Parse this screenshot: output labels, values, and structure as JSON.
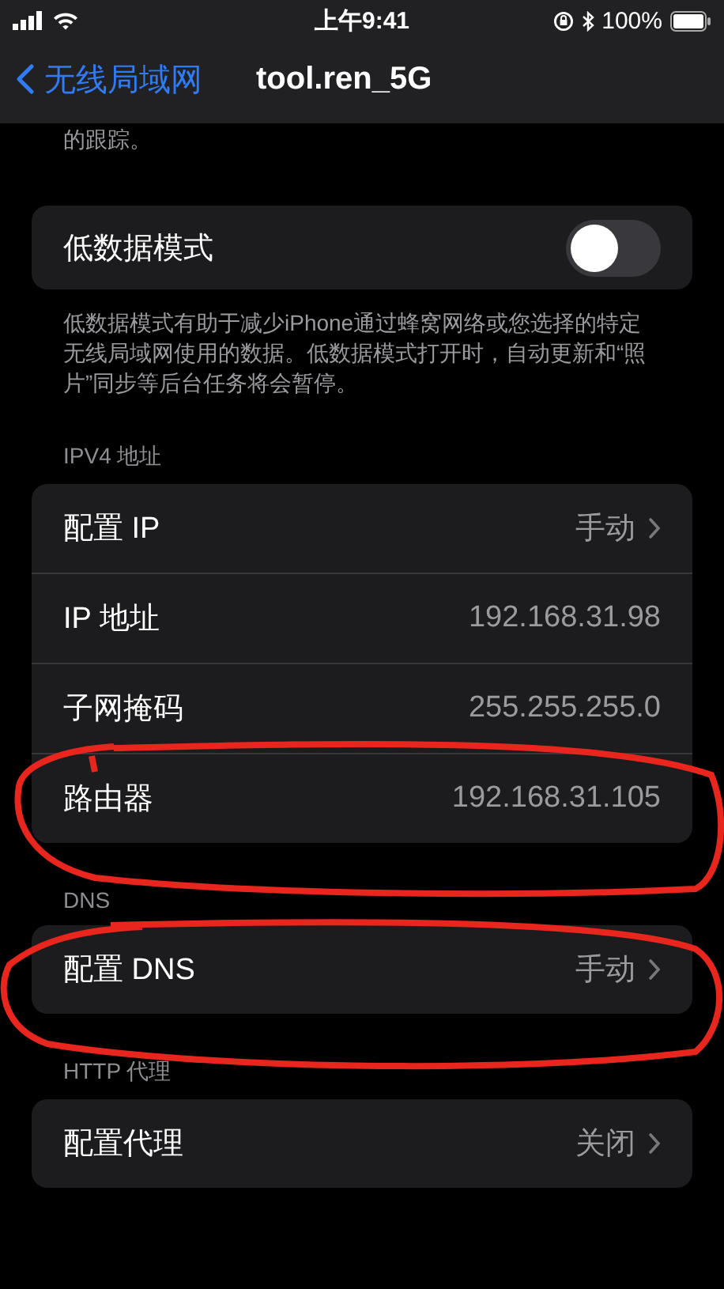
{
  "status_bar": {
    "time": "上午9:41",
    "battery": "100%"
  },
  "nav": {
    "back": "无线局域网",
    "title": "tool.ren_5G"
  },
  "top_note": "的跟踪。",
  "low_data": {
    "label": "低数据模式",
    "on": false,
    "footer": "低数据模式有助于减少iPhone通过蜂窝网络或您选择的特定无线局域网使用的数据。低数据模式打开时，自动更新和“照片”同步等后台任务将会暂停。"
  },
  "sections": [
    {
      "header": "IPV4 地址",
      "rows": [
        {
          "kind": "link",
          "label": "配置 IP",
          "value": "手动"
        },
        {
          "kind": "value",
          "label": "IP 地址",
          "value": "192.168.31.98"
        },
        {
          "kind": "value",
          "label": "子网掩码",
          "value": "255.255.255.0"
        },
        {
          "kind": "value",
          "label": "路由器",
          "value": "192.168.31.105"
        }
      ]
    },
    {
      "header": "DNS",
      "rows": [
        {
          "kind": "link",
          "label": "配置 DNS",
          "value": "手动"
        }
      ]
    },
    {
      "header": "HTTP 代理",
      "rows": [
        {
          "kind": "link",
          "label": "配置代理",
          "value": "关闭"
        }
      ]
    }
  ]
}
